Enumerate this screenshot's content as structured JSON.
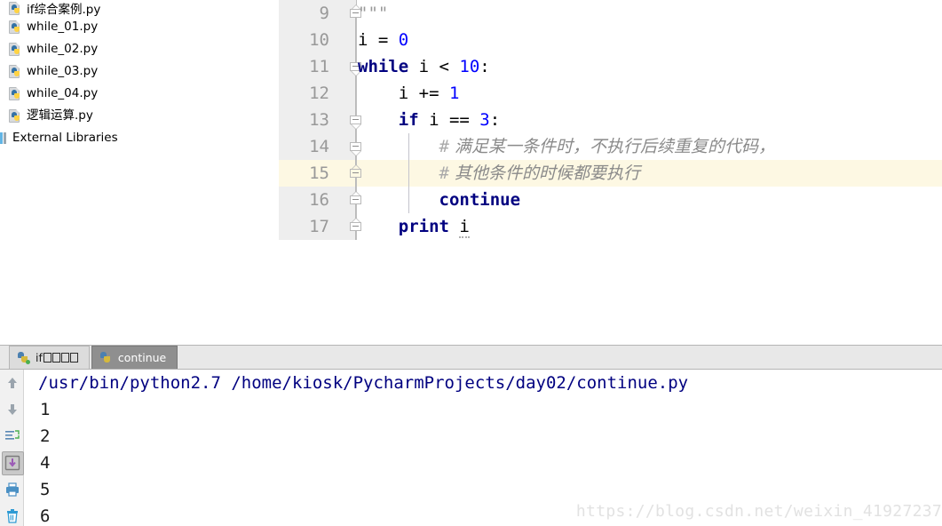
{
  "sidebar": {
    "items": [
      {
        "label": "if综合案例.py",
        "icon": "python-file-icon"
      },
      {
        "label": "while_01.py",
        "icon": "python-file-icon"
      },
      {
        "label": "while_02.py",
        "icon": "python-file-icon"
      },
      {
        "label": "while_03.py",
        "icon": "python-file-icon"
      },
      {
        "label": "while_04.py",
        "icon": "python-file-icon"
      },
      {
        "label": "逻辑运算.py",
        "icon": "python-file-icon"
      }
    ],
    "external_libraries": {
      "label": "External Libraries",
      "icon": "library-icon"
    }
  },
  "editor": {
    "lines": [
      {
        "num": "9",
        "indent": 0,
        "parts": [
          {
            "t": "\"\"\"",
            "c": "str"
          }
        ]
      },
      {
        "num": "10",
        "indent": 0,
        "parts": [
          {
            "t": "i = ",
            "c": "def"
          },
          {
            "t": "0",
            "c": "num"
          }
        ]
      },
      {
        "num": "11",
        "indent": 0,
        "parts": [
          {
            "t": "while",
            "c": "kw"
          },
          {
            "t": " i < ",
            "c": "def"
          },
          {
            "t": "10",
            "c": "num"
          },
          {
            "t": ":",
            "c": "def"
          }
        ]
      },
      {
        "num": "12",
        "indent": 0,
        "parts": [
          {
            "t": "    i += ",
            "c": "def"
          },
          {
            "t": "1",
            "c": "num"
          }
        ]
      },
      {
        "num": "13",
        "indent": 0,
        "parts": [
          {
            "t": "    ",
            "c": "def"
          },
          {
            "t": "if",
            "c": "kw"
          },
          {
            "t": " i == ",
            "c": "def"
          },
          {
            "t": "3",
            "c": "num"
          },
          {
            "t": ":",
            "c": "def"
          }
        ]
      },
      {
        "num": "14",
        "indent": 0,
        "parts": [
          {
            "t": "        ",
            "c": "def"
          },
          {
            "t": "#",
            "c": "hash"
          },
          {
            "t": " 满足某一条件时，不执行后续重复的代码，",
            "c": "cmt"
          }
        ]
      },
      {
        "num": "15",
        "indent": 0,
        "parts": [
          {
            "t": "        ",
            "c": "def"
          },
          {
            "t": "#",
            "c": "hash"
          },
          {
            "t": " 其他条件的时候都要执行",
            "c": "cmt"
          }
        ]
      },
      {
        "num": "16",
        "indent": 0,
        "parts": [
          {
            "t": "        ",
            "c": "def"
          },
          {
            "t": "continue",
            "c": "kw"
          }
        ]
      },
      {
        "num": "17",
        "indent": 0,
        "parts": [
          {
            "t": "    ",
            "c": "def"
          },
          {
            "t": "print",
            "c": "kw"
          },
          {
            "t": " ",
            "c": "def"
          },
          {
            "t": "i",
            "c": "squig"
          }
        ]
      }
    ],
    "highlighted_line": "15",
    "colors": {
      "keyword": "#000080",
      "number": "#0000ff",
      "comment": "#8a8a8a",
      "string": "#999999",
      "caret_line_bg": "#fdf8e3",
      "gutter_bg": "#eeeeee"
    }
  },
  "run_panel": {
    "tabs": [
      {
        "label": "if",
        "boxes": 4,
        "active": false,
        "running_dot": true,
        "icon": "python-run-icon"
      },
      {
        "label": "continue",
        "boxes": 0,
        "active": true,
        "running_dot": false,
        "icon": "python-run-icon"
      }
    ],
    "toolbar": [
      {
        "name": "scroll-up-button",
        "icon": "arrow-up-icon",
        "pressed": false
      },
      {
        "name": "scroll-down-button",
        "icon": "arrow-down-icon",
        "pressed": false
      },
      {
        "name": "soft-wrap-button",
        "icon": "soft-wrap-icon",
        "pressed": false
      },
      {
        "name": "scroll-to-end-button",
        "icon": "scroll-to-end-icon",
        "pressed": true
      },
      {
        "name": "print-button",
        "icon": "printer-icon",
        "pressed": false
      },
      {
        "name": "clear-all-button",
        "icon": "trash-icon",
        "pressed": false
      }
    ],
    "console": {
      "command": "/usr/bin/python2.7 /home/kiosk/PycharmProjects/day02/continue.py",
      "output": [
        "1",
        "2",
        "4",
        "5",
        "6"
      ]
    }
  },
  "watermark": {
    "text": "https://blog.csdn.net/weixin_41927237"
  }
}
